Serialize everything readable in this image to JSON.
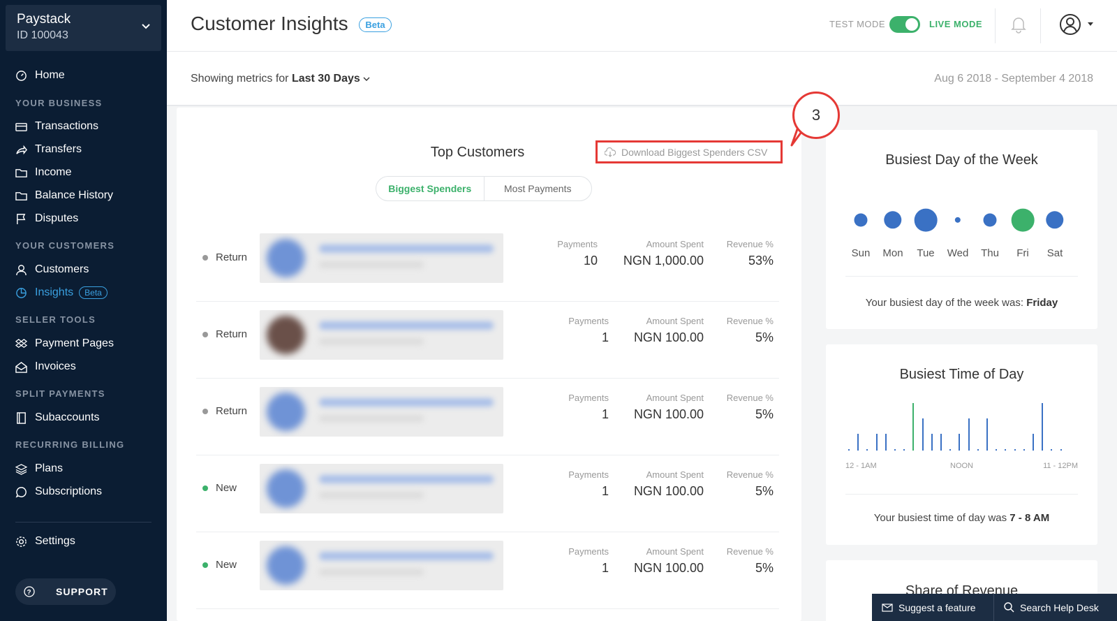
{
  "account": {
    "name": "Paystack",
    "id": "ID 100043"
  },
  "nav": {
    "home": "Home",
    "your_business": "YOUR BUSINESS",
    "transactions": "Transactions",
    "transfers": "Transfers",
    "income": "Income",
    "balance_history": "Balance History",
    "disputes": "Disputes",
    "your_customers": "YOUR CUSTOMERS",
    "customers": "Customers",
    "insights": "Insights",
    "insights_badge": "Beta",
    "seller_tools": "SELLER TOOLS",
    "payment_pages": "Payment Pages",
    "invoices": "Invoices",
    "split_payments": "SPLIT PAYMENTS",
    "subaccounts": "Subaccounts",
    "recurring_billing": "RECURRING BILLING",
    "plans": "Plans",
    "subscriptions": "Subscriptions",
    "settings": "Settings",
    "support": "SUPPORT"
  },
  "header": {
    "title": "Customer Insights",
    "badge": "Beta",
    "test_mode": "TEST MODE",
    "live_mode": "LIVE MODE"
  },
  "metrics": {
    "prefix": "Showing metrics for",
    "period": "Last 30 Days",
    "range": "Aug 6 2018 - September 4 2018"
  },
  "top_customers": {
    "title": "Top Customers",
    "download_label": "Download Biggest Spenders CSV",
    "tabs": [
      "Biggest Spenders",
      "Most Payments"
    ],
    "col_labels": {
      "payments": "Payments",
      "amount": "Amount Spent",
      "revenue": "Revenue %"
    },
    "rows": [
      {
        "status": "Return",
        "payments": "10",
        "amount": "NGN 1,000.00",
        "revenue": "53%"
      },
      {
        "status": "Return",
        "payments": "1",
        "amount": "NGN 100.00",
        "revenue": "5%"
      },
      {
        "status": "Return",
        "payments": "1",
        "amount": "NGN 100.00",
        "revenue": "5%"
      },
      {
        "status": "New",
        "payments": "1",
        "amount": "NGN 100.00",
        "revenue": "5%"
      },
      {
        "status": "New",
        "payments": "1",
        "amount": "NGN 100.00",
        "revenue": "5%"
      }
    ]
  },
  "busiest_day": {
    "title": "Busiest Day of the Week",
    "days": [
      "Sun",
      "Mon",
      "Tue",
      "Wed",
      "Thu",
      "Fri",
      "Sat"
    ],
    "relative_size": [
      0.5,
      0.67,
      0.86,
      0.22,
      0.5,
      0.86,
      0.67
    ],
    "highlight": "Fri",
    "summary_prefix": "Your busiest day of the week was:",
    "summary_value": "Friday"
  },
  "busiest_time": {
    "title": "Busiest Time of Day",
    "hourly_relative": [
      0.03,
      0.36,
      0.03,
      0.36,
      0.36,
      0.03,
      0.03,
      1.0,
      0.68,
      0.36,
      0.36,
      0.03,
      0.36,
      0.68,
      0.03,
      0.68,
      0.03,
      0.03,
      0.03,
      0.03,
      0.36,
      1.0,
      0.03,
      0.03
    ],
    "peak_index": 7,
    "axis_labels": [
      "12 - 1AM",
      "NOON",
      "11 - 12PM"
    ],
    "summary_prefix": "Your busiest time of day was",
    "summary_value": "7 - 8 AM"
  },
  "share_of_revenue": {
    "title": "Share of Revenue"
  },
  "footer": {
    "suggest": "Suggest a feature",
    "search": "Search Help Desk"
  },
  "annotation": {
    "step": "3"
  },
  "colors": {
    "accent_green": "#3cb16b",
    "accent_blue": "#3a71c4",
    "sidebar": "#0b1d33",
    "highlight_red": "#e53935"
  }
}
